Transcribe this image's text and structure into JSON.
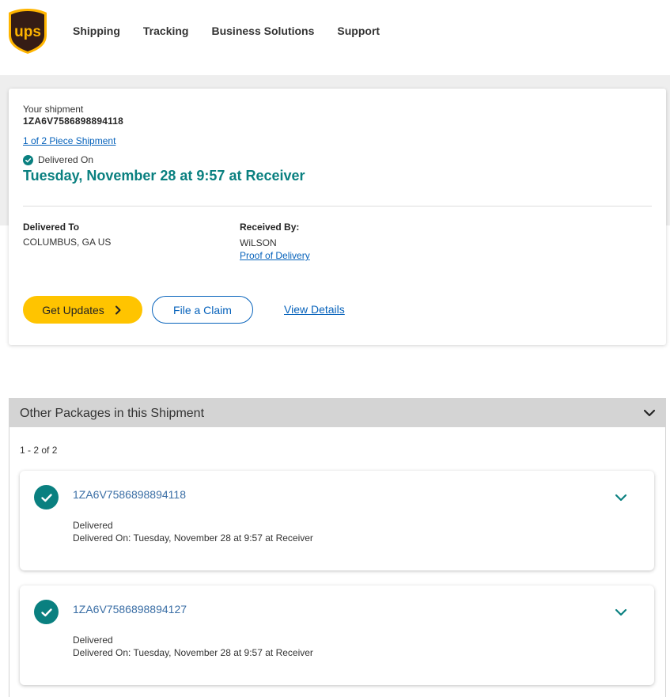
{
  "header": {
    "brand": "ups",
    "nav": [
      "Shipping",
      "Tracking",
      "Business Solutions",
      "Support"
    ]
  },
  "shipment": {
    "heading": "Your shipment",
    "tracking_number": "1ZA6V7586898894118",
    "piece_link": "1 of 2 Piece Shipment",
    "status_label": "Delivered On",
    "delivered_date": "Tuesday, November 28 at 9:57 at Receiver",
    "delivered_to_label": "Delivered To",
    "delivered_to_value": "COLUMBUS, GA US",
    "received_by_label": "Received By:",
    "received_by_value": "WiLSON",
    "proof_link": "Proof of Delivery",
    "get_updates": "Get Updates",
    "file_claim": "File a Claim",
    "view_details": "View Details"
  },
  "other_packages": {
    "title": "Other Packages in this Shipment",
    "count": "1 - 2 of 2",
    "items": [
      {
        "tracking": "1ZA6V7586898894118",
        "status": "Delivered",
        "date": "Delivered On: Tuesday, November 28 at 9:57 at Receiver"
      },
      {
        "tracking": "1ZA6V7586898894127",
        "status": "Delivered",
        "date": "Delivered On: Tuesday, November 28 at 9:57 at Receiver"
      }
    ]
  },
  "colors": {
    "ups_brown": "#351c15",
    "ups_gold": "#ffb500",
    "teal": "#0a8080",
    "link_blue": "#0662bb",
    "button_yellow": "#ffc400"
  },
  "icons": {
    "logo": "ups-shield-logo",
    "status": "check-circle-icon",
    "expand": "chevron-down-icon",
    "button_arrow": "chevron-right-icon"
  }
}
